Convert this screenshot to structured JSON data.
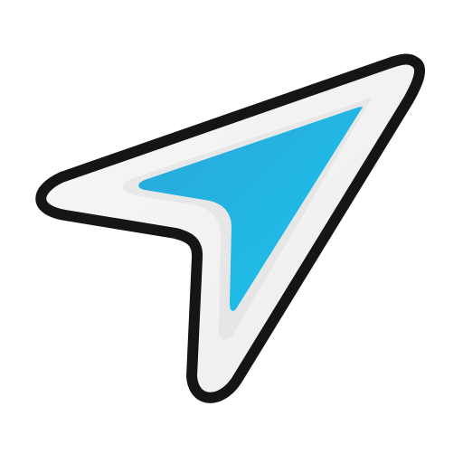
{
  "icon": {
    "name": "navigation-arrow-icon",
    "colors": {
      "outline": "#151515",
      "body": "#ededed",
      "body_highlight": "#f7f7f7",
      "accent_top": "#2aa7d8",
      "accent_bottom": "#1bc3ee"
    }
  }
}
